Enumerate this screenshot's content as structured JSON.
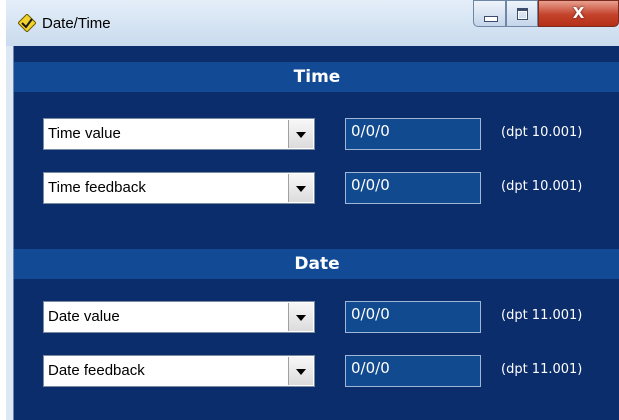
{
  "window": {
    "title": "Date/Time",
    "app_icon": "yellow-diamond-check-icon",
    "close_label": "X"
  },
  "sections": [
    {
      "header": "Time",
      "rows": [
        {
          "dropdown": "Time value",
          "address": "0/0/0",
          "dpt": "(dpt 10.001)"
        },
        {
          "dropdown": "Time feedback",
          "address": "0/0/0",
          "dpt": "(dpt 10.001)"
        }
      ]
    },
    {
      "header": "Date",
      "rows": [
        {
          "dropdown": "Date value",
          "address": "0/0/0",
          "dpt": "(dpt 11.001)"
        },
        {
          "dropdown": "Date feedback",
          "address": "0/0/0",
          "dpt": "(dpt 11.001)"
        }
      ]
    }
  ],
  "colors": {
    "client_bg": "#0b2d6b",
    "header_bg": "#124a95",
    "field_bg": "#114a8e"
  }
}
